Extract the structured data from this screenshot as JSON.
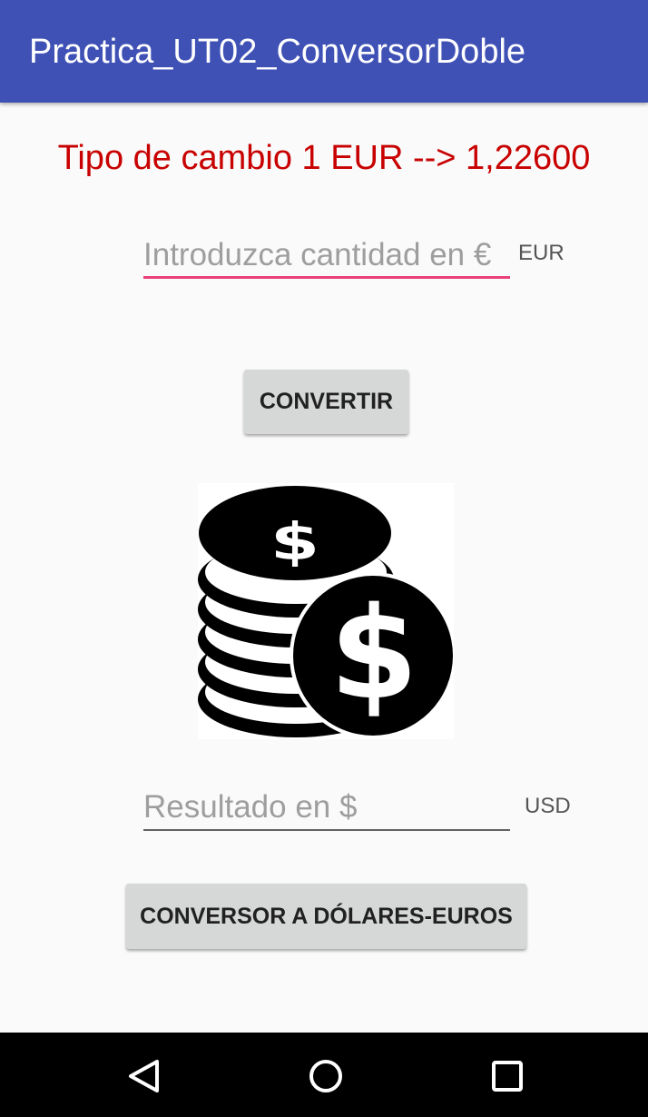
{
  "app_bar": {
    "title": "Practica_UT02_ConversorDoble",
    "color": "#3f51b5"
  },
  "exchange": {
    "rate_text": "Tipo de cambio 1 EUR --> 1,22600",
    "color": "#c80000"
  },
  "input_eur": {
    "value": "",
    "placeholder": "Introduzca cantidad en €",
    "unit": "EUR",
    "underline_color": "#ec407a"
  },
  "buttons": {
    "convert_label": "CONVERTIR",
    "switch_label": "CONVERSOR A DÓLARES-EUROS"
  },
  "image": {
    "icon": "dollar-coins-icon"
  },
  "result_usd": {
    "value": "",
    "placeholder": "Resultado en $",
    "unit": "USD"
  },
  "nav": {
    "back_icon": "back-triangle-icon",
    "home_icon": "home-circle-icon",
    "recents_icon": "recents-square-icon"
  }
}
